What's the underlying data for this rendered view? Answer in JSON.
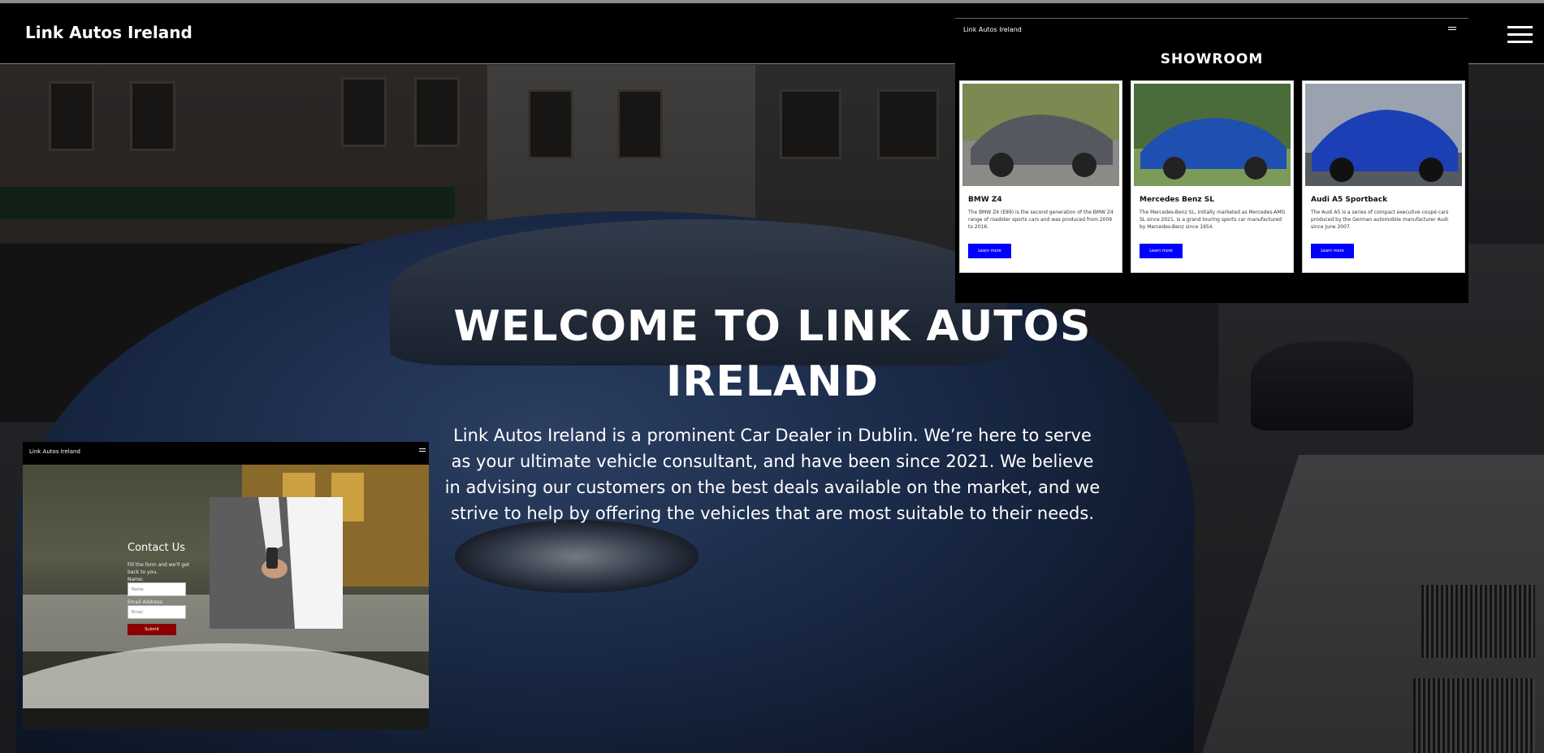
{
  "navbar": {
    "brand": "Link Autos Ireland"
  },
  "hero": {
    "title": "WELCOME TO LINK AUTOS IRELAND",
    "text": "Link Autos Ireland is a prominent Car Dealer in Dublin. We’re here to serve as your ultimate vehicle consultant, and have been since 2021. We believe in advising our customers on the best deals available on the market, and we strive to help by offering the vehicles that are most suitable to their needs."
  },
  "showroom_preview": {
    "brand": "Link Autos Ireland",
    "title": "SHOWROOM",
    "cards": [
      {
        "name": "BMW Z4",
        "desc": "The BMW Z4 (E89) is the second generation of the BMW Z4 range of roadster sports cars and was produced from 2009 to 2016.",
        "button": "Learn more",
        "color": "#55585e"
      },
      {
        "name": "Mercedes Benz SL",
        "desc": "The Mercedes-Benz SL, initially marketed as Mercedes-AMG SL since 2021, is a grand touring sports car manufactured by Mercedes-Benz since 1954.",
        "button": "Learn more",
        "color": "#1f4fb0"
      },
      {
        "name": "Audi A5 Sportback",
        "desc": "The Audi A5 is a series of compact executive coupé cars produced by the German automobile manufacturer Audi since June 2007.",
        "button": "Learn more",
        "color": "#1c3fb5"
      }
    ]
  },
  "contact_preview": {
    "brand": "Link Autos Ireland",
    "title": "Contact Us",
    "subtitle": "Fill the form and we'll get back to you.",
    "name_label": "Name:",
    "name_placeholder": "Name",
    "email_label": "Email Address:",
    "email_placeholder": "Email",
    "submit": "Submit"
  }
}
